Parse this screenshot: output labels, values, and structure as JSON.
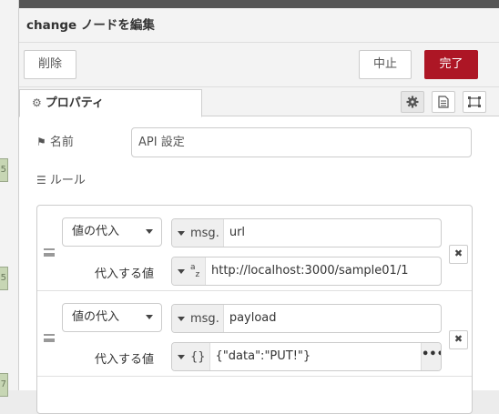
{
  "workspace": {
    "stub_marks": [
      "5",
      "5",
      "7"
    ]
  },
  "dialog": {
    "title": "change ノードを編集",
    "delete_label": "削除",
    "cancel_label": "中止",
    "done_label": "完了",
    "done_color": "#ad1625"
  },
  "tabs": {
    "properties_label": "プロパティ",
    "icons": [
      "gear-icon",
      "description-icon",
      "appearance-icon"
    ]
  },
  "form": {
    "name_label": "名前",
    "name_value": "API 設定",
    "rules_label": "ルール"
  },
  "rules": [
    {
      "action": "値の代入",
      "target_type": "msg.",
      "target_value": "url",
      "value_label": "代入する値",
      "value_type_icon": "a z",
      "value": "http://localhost:3000/sample01/1"
    },
    {
      "action": "値の代入",
      "target_type": "msg.",
      "target_value": "payload",
      "value_label": "代入する値",
      "value_type_icon": "{}",
      "value": "{\"data\":\"PUT!\"}",
      "expand_label": "•••"
    }
  ]
}
